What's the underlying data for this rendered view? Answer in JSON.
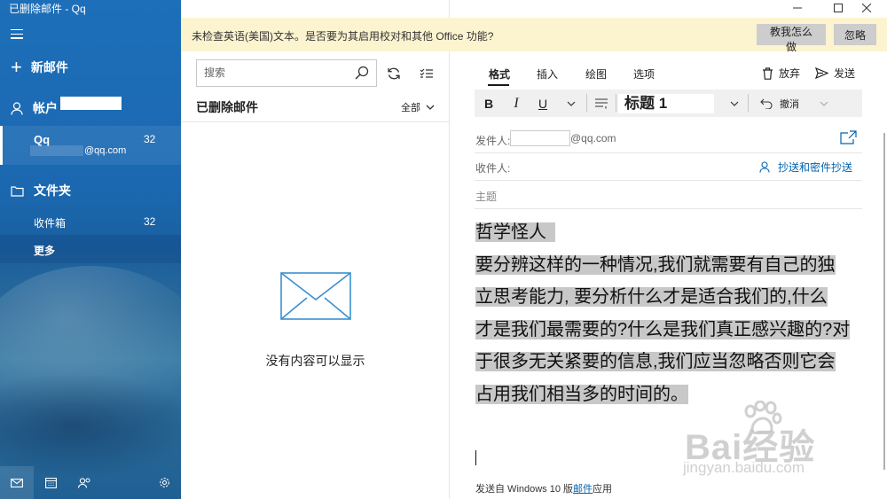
{
  "window": {
    "title": "已删除邮件 - Qq",
    "controls": [
      "minimize",
      "maximize",
      "close"
    ]
  },
  "sidebar": {
    "new_mail": "新邮件",
    "accounts": "帐户",
    "account": {
      "name": "Qq",
      "count": "32",
      "email": "@qq.com"
    },
    "folders": "文件夹",
    "items": [
      {
        "label": "收件箱",
        "count": "32"
      },
      {
        "label": "更多",
        "count": ""
      }
    ],
    "bottom_icons": [
      "mail-icon",
      "calendar-icon",
      "people-icon",
      "settings-icon"
    ]
  },
  "list": {
    "search_placeholder": "搜索",
    "title": "已删除邮件",
    "filter": "全部",
    "empty_text": "没有内容可以显示"
  },
  "notice": {
    "text": "未检查英语(美国)文本。是否要为其启用校对和其他 Office 功能?",
    "show_me": "教我怎么做",
    "ignore": "忽略"
  },
  "compose": {
    "tabs": [
      "格式",
      "插入",
      "绘图",
      "选项"
    ],
    "active_tab": 0,
    "discard": "放弃",
    "send": "发送",
    "toolbar": {
      "bold": "B",
      "italic": "I",
      "underline": "U",
      "style": "标题 1",
      "undo": "撤消"
    },
    "from_label": "发件人:",
    "from_domain": "@qq.com",
    "to_label": "收件人:",
    "cc_bcc": "抄送和密件抄送",
    "subject_label": "主题",
    "body_title": "哲学怪人",
    "body_lines": [
      "要分辨这样的一种情况,我们就需要有自己的独",
      "立思考能力, 要分析什么才是适合我们的,什么",
      "才是我们最需要的?什么是我们真正感兴趣的?对",
      "于很多无关紧要的信息,我们应当忽略否则它会",
      "占用我们相当多的时间的。"
    ],
    "signature_prefix": "发送自 Windows 10 版",
    "signature_link": "邮件",
    "signature_suffix": "应用"
  },
  "watermark": {
    "brand": "Bai经验",
    "url": "jingyan.baidu.com"
  },
  "colors": {
    "sidebar": "#1b68b0",
    "notice_bg": "#fcf3cf",
    "link": "#0063b1",
    "highlight": "#c8c8c8"
  }
}
